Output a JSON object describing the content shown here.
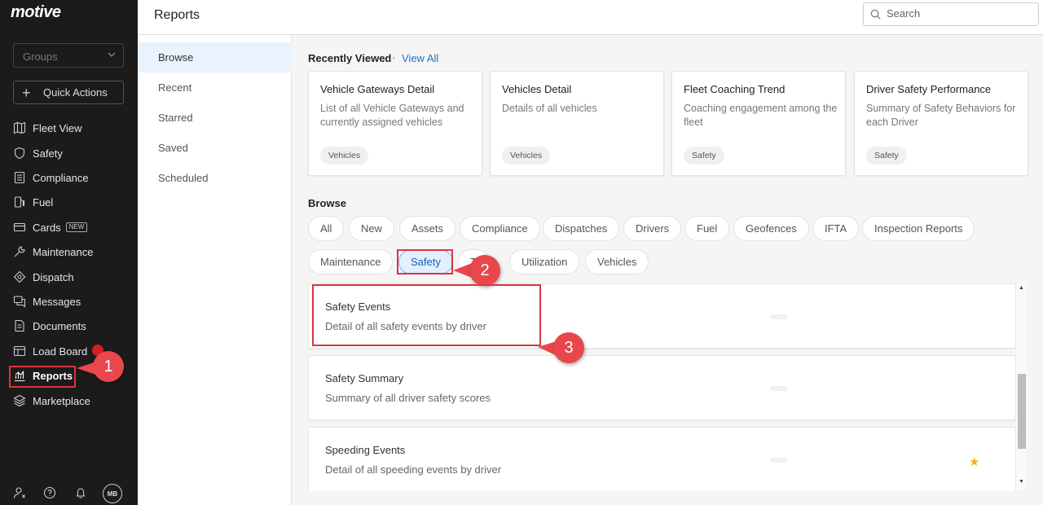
{
  "sidebar": {
    "logo": "motive",
    "groups_placeholder": "Groups",
    "quick_actions": "Quick Actions",
    "items": [
      {
        "label": "Fleet View",
        "icon": "map-icon"
      },
      {
        "label": "Safety",
        "icon": "shield-icon"
      },
      {
        "label": "Compliance",
        "icon": "document-list-icon"
      },
      {
        "label": "Fuel",
        "icon": "fuel-pump-icon"
      },
      {
        "label": "Cards",
        "icon": "card-icon",
        "badge": "NEW"
      },
      {
        "label": "Maintenance",
        "icon": "wrench-icon"
      },
      {
        "label": "Dispatch",
        "icon": "dispatch-pin-icon"
      },
      {
        "label": "Messages",
        "icon": "messages-icon"
      },
      {
        "label": "Documents",
        "icon": "documents-icon"
      },
      {
        "label": "Load Board",
        "icon": "load-board-icon"
      },
      {
        "label": "Reports",
        "icon": "reports-chart-icon",
        "active": true
      },
      {
        "label": "Marketplace",
        "icon": "layers-icon"
      }
    ],
    "avatar_initials": "MB"
  },
  "header": {
    "title": "Reports",
    "search_placeholder": "Search"
  },
  "subnav": {
    "items": [
      "Browse",
      "Recent",
      "Starred",
      "Saved",
      "Scheduled"
    ],
    "active": "Browse"
  },
  "recently_viewed": {
    "title": "Recently Viewed",
    "separator": "·",
    "view_all": "View All",
    "cards": [
      {
        "title": "Vehicle Gateways Detail",
        "desc": "List of all Vehicle Gateways and currently assigned vehicles",
        "tag": "Vehicles"
      },
      {
        "title": "Vehicles Detail",
        "desc": "Details of all vehicles",
        "tag": "Vehicles"
      },
      {
        "title": "Fleet Coaching Trend",
        "desc": "Coaching engagement among the fleet",
        "tag": "Safety"
      },
      {
        "title": "Driver Safety Performance",
        "desc": "Summary of Safety Behaviors for each Driver",
        "tag": "Safety"
      }
    ]
  },
  "browse": {
    "title": "Browse",
    "chips_row1": [
      "All",
      "New",
      "Assets",
      "Compliance",
      "Dispatches",
      "Drivers",
      "Fuel",
      "Geofences",
      "IFTA",
      "Inspection Reports"
    ],
    "chips_row2": [
      "Maintenance",
      "Safety",
      "T",
      "Utilization",
      "Vehicles"
    ],
    "active_chip": "Safety"
  },
  "reports": [
    {
      "title": "Safety Events",
      "desc": "Detail of all safety events by driver",
      "starred": false
    },
    {
      "title": "Safety Summary",
      "desc": "Summary of all driver safety scores",
      "starred": false
    },
    {
      "title": "Speeding Events",
      "desc": "Detail of all speeding events by driver",
      "starred": true
    }
  ],
  "callouts": [
    "1",
    "2",
    "3"
  ],
  "colors": {
    "sidebar_bg": "#1b1b1b",
    "accent_blue": "#1a73c8",
    "callout_red": "#e8474c",
    "star": "#f2b01e"
  }
}
